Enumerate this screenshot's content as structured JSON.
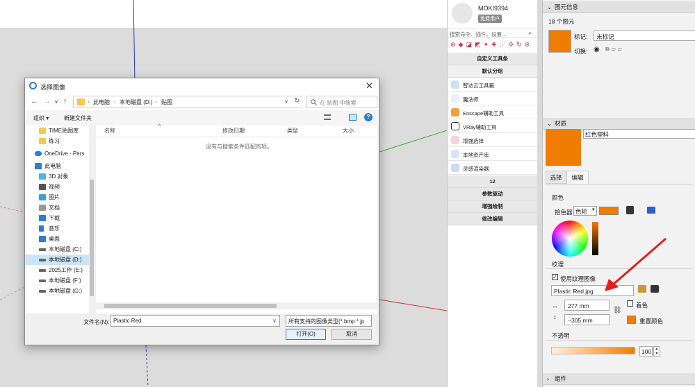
{
  "dialog": {
    "title": "选择图像",
    "close": "✕",
    "nav": {
      "back": "←",
      "forward": "→",
      "recent": "∨",
      "up": "↑"
    },
    "address": {
      "parts": [
        "此电脑",
        "本地磁盘 (D:)",
        "贴图"
      ],
      "sep": "›",
      "dropdown": "∨",
      "refresh": "↻"
    },
    "search_placeholder": "在 贴图 中搜索",
    "toolbar": {
      "organize": "组织 ▾",
      "new_folder": "新建文件夹"
    },
    "nav_items": [
      {
        "label": "TIME贴图库",
        "icon": "folder-icon",
        "color": "#f3c84b"
      },
      {
        "label": "练习",
        "icon": "folder-icon",
        "color": "#f3c84b"
      },
      {
        "label": "OneDrive - Pers",
        "icon": "cloud-icon",
        "color": "#2b7dd6"
      },
      {
        "label": "此电脑",
        "icon": "computer-icon",
        "color": "#2b7dd6"
      },
      {
        "label": "3D 对象",
        "icon": "cube-icon",
        "color": "#4fb3e8"
      },
      {
        "label": "视频",
        "icon": "video-icon",
        "color": "#555"
      },
      {
        "label": "图片",
        "icon": "picture-icon",
        "color": "#3aa0d8"
      },
      {
        "label": "文档",
        "icon": "document-icon",
        "color": "#777"
      },
      {
        "label": "下载",
        "icon": "download-icon",
        "color": "#2b7dd6"
      },
      {
        "label": "音乐",
        "icon": "music-icon",
        "color": "#2b7dd6"
      },
      {
        "label": "桌面",
        "icon": "desktop-icon",
        "color": "#2b7dd6"
      },
      {
        "label": "本地磁盘 (C:)",
        "icon": "drive-icon",
        "color": "#666"
      },
      {
        "label": "本地磁盘 (D:)",
        "icon": "drive-icon",
        "color": "#666"
      },
      {
        "label": "2025工作 (E:)",
        "icon": "drive-icon",
        "color": "#666"
      },
      {
        "label": "本地磁盘 (F:)",
        "icon": "drive-icon",
        "color": "#666"
      },
      {
        "label": "本地磁盘 (G:)",
        "icon": "drive-icon",
        "color": "#666"
      }
    ],
    "columns": [
      "名称",
      "修改日期",
      "类型",
      "大小"
    ],
    "empty_message": "没有与搜索条件匹配的项。",
    "filename_label": "文件名(N):",
    "filename_value": "Plastic Red",
    "filetype_value": "所有支持的图像类型(*.bmp *.jp",
    "open_button": "打开(O)",
    "cancel_button": "取消"
  },
  "plugin_panel": {
    "username": "MOKI9394",
    "badge": "免费用户",
    "search_placeholder": "搜索命令、插件、设置...",
    "custom_toolbar": "自定义工具条",
    "default_group": "默认分组",
    "items": [
      {
        "label": "智达云工具箱",
        "color": "#cfe0f5"
      },
      {
        "label": "魔法师",
        "color": "#e8f0fb"
      },
      {
        "label": "Enscape辅助工具",
        "color": "#f0a040"
      },
      {
        "label": "VRay辅助工具",
        "color": "#333333"
      },
      {
        "label": "增强选择",
        "color": "#f3d5d5"
      },
      {
        "label": "本地资产库",
        "color": "#d9e4f7"
      },
      {
        "label": "灵感渲染器",
        "color": "#c9dcf2"
      }
    ],
    "section_headers": [
      "12",
      "参数驱动",
      "增强绘制",
      "修改编辑"
    ]
  },
  "tray": {
    "entity_info_title": "图元信息",
    "entity_count": "18 个图元",
    "tag_label": "标记:",
    "tag_value": "未标记",
    "toggle_label": "切换:",
    "materials_title": "材质",
    "material_name": "红色塑料",
    "tabs": [
      "选择",
      "编辑"
    ],
    "color_title": "颜色",
    "picker_label": "拾色器:",
    "picker_mode": "色轮",
    "texture_title": "纹理",
    "use_texture_label": "使用纹理图像",
    "texture_file": "Plastic Red.jpg",
    "width_value": "277 mm",
    "height_value": "~305 mm",
    "colorize_label": "着色",
    "reset_color_label": "重置颜色",
    "opacity_title": "不透明",
    "opacity_value": "100",
    "components_title": "组件",
    "accent_color": "#f07c00"
  }
}
